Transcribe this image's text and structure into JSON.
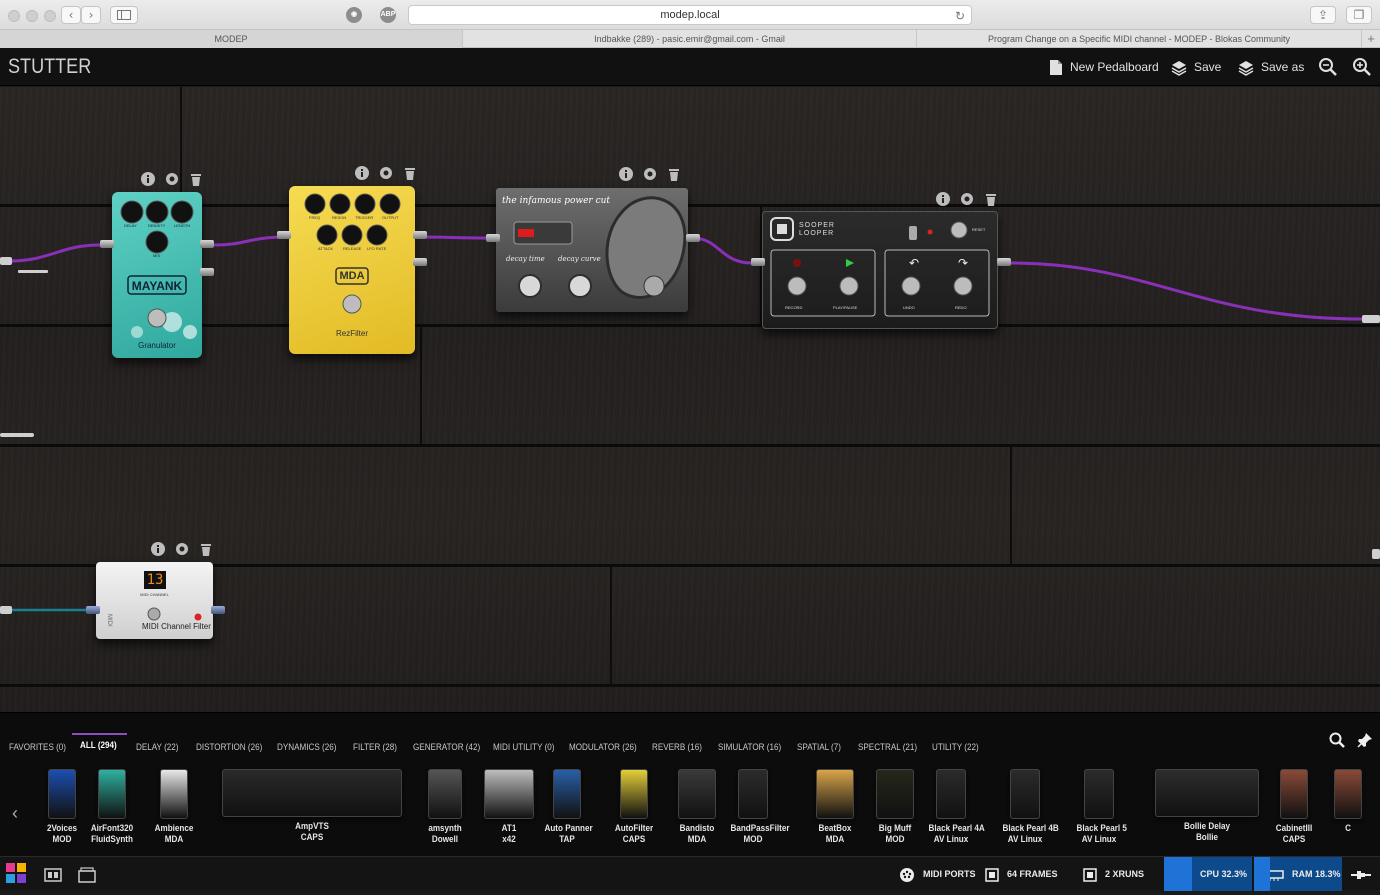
{
  "browser": {
    "address": "modep.local",
    "tabs": [
      "MODEP",
      "Indbakke (289) - pasic.emir@gmail.com - Gmail",
      "Program Change on a Specific MIDI channel - MODEP - Blokas Community"
    ],
    "extensions": [
      "ABP"
    ]
  },
  "header": {
    "pedalboard_title": "STUTTER",
    "new_pedalboard_label": "New Pedalboard",
    "save_label": "Save",
    "save_as_label": "Save as"
  },
  "pedals": {
    "granulator": {
      "brand": "MAYANK",
      "name": "Granulator",
      "knob_labels": [
        "DELAY",
        "DENSITY",
        "LENGTH",
        "MIX"
      ],
      "color": "#3fb6ad"
    },
    "rezfilter": {
      "brand": "MDA",
      "name": "RezFilter",
      "knob_labels": [
        "FREQ",
        "RESON",
        "TRIGGER",
        "OUTPUT",
        "ATTACK",
        "RELEASE",
        "LFO RATE"
      ],
      "color": "#f1cf3a"
    },
    "powercut": {
      "title": "the infamous power cut",
      "knob_labels": [
        "decay time",
        "decay curve"
      ]
    },
    "sooperlooper": {
      "title_line1": "SOOPER",
      "title_line2": "LOOPER",
      "reset_label": "RESET",
      "button_labels": [
        "RECORD",
        "PLAY/PAUSE",
        "UNDO",
        "REDO"
      ]
    },
    "midichannel": {
      "display": "13",
      "channel_label": "MIDI CHANNEL",
      "name": "MIDI Channel Filter"
    }
  },
  "categories": [
    {
      "label": "FAVORITES (0)",
      "active": false
    },
    {
      "label": "ALL (294)",
      "active": true
    },
    {
      "label": "DELAY (22)",
      "active": false
    },
    {
      "label": "DISTORTION (26)",
      "active": false
    },
    {
      "label": "DYNAMICS (26)",
      "active": false
    },
    {
      "label": "FILTER (28)",
      "active": false
    },
    {
      "label": "GENERATOR (42)",
      "active": false
    },
    {
      "label": "MIDI UTILITY (0)",
      "active": false
    },
    {
      "label": "MODULATOR (26)",
      "active": false
    },
    {
      "label": "REVERB (16)",
      "active": false
    },
    {
      "label": "SIMULATOR (16)",
      "active": false
    },
    {
      "label": "SPATIAL (7)",
      "active": false
    },
    {
      "label": "SPECTRAL (21)",
      "active": false
    },
    {
      "label": "UTILITY (22)",
      "active": false
    }
  ],
  "plugins": [
    {
      "name": "2Voices",
      "brand": "MOD",
      "color": "#1b4fb0",
      "icon": "stompbox"
    },
    {
      "name": "AirFont320",
      "brand": "FluidSynth",
      "color": "#2fb0a0",
      "icon": "stompbox"
    },
    {
      "name": "Ambience",
      "brand": "MDA",
      "color": "#e8e8e8",
      "icon": "stompbox"
    },
    {
      "name": "AmpVTS",
      "brand": "CAPS",
      "color": "#2a2a2a",
      "icon": "amp-head"
    },
    {
      "name": "amsynth",
      "brand": "Dowell",
      "color": "#555555",
      "icon": "synth"
    },
    {
      "name": "AT1",
      "brand": "x42",
      "color": "#bdbdbd",
      "icon": "keyboard"
    },
    {
      "name": "Auto Panner",
      "brand": "TAP",
      "color": "#2a5fa8",
      "icon": "stompbox"
    },
    {
      "name": "AutoFilter",
      "brand": "CAPS",
      "color": "#e3cf3a",
      "icon": "stompbox"
    },
    {
      "name": "Bandisto",
      "brand": "MDA",
      "color": "#3a3a3a",
      "icon": "stompbox"
    },
    {
      "name": "BandPassFilter",
      "brand": "MOD",
      "color": "#2c2c2c",
      "icon": "stompbox"
    },
    {
      "name": "BeatBox",
      "brand": "MDA",
      "color": "#d9a44a",
      "icon": "stompbox"
    },
    {
      "name": "Big Muff",
      "brand": "MOD",
      "color": "#25281a",
      "icon": "stompbox"
    },
    {
      "name": "Black Pearl 4A",
      "brand": "AV Linux",
      "color": "#2b2b2b",
      "icon": "stompbox"
    },
    {
      "name": "Black Pearl 4B",
      "brand": "AV Linux",
      "color": "#2b2b2b",
      "icon": "stompbox"
    },
    {
      "name": "Black Pearl 5",
      "brand": "AV Linux",
      "color": "#2b2b2b",
      "icon": "stompbox"
    },
    {
      "name": "Bollie Delay",
      "brand": "Bollie",
      "color": "#2d2d2d",
      "icon": "wide-unit"
    },
    {
      "name": "CabinetIII",
      "brand": "CAPS",
      "color": "#8a4a38",
      "icon": "stompbox"
    },
    {
      "name": "C",
      "brand": "",
      "color": "#8a4a38",
      "icon": "stompbox"
    }
  ],
  "status": {
    "midi_ports_label": "MIDI PORTS",
    "frames_label": "64 FRAMES",
    "xruns_label": "2 XRUNS",
    "cpu_label": "CPU 32.3%",
    "cpu_value": 32.3,
    "ram_label": "RAM 18.3%",
    "ram_value": 18.3
  }
}
